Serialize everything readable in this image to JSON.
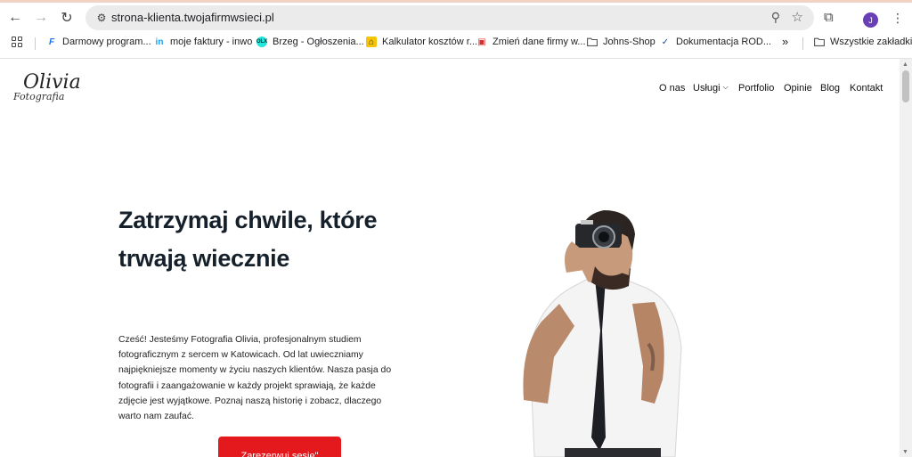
{
  "browser": {
    "url": "strona-klienta.twojafirmwsieci.pl",
    "profile_initial": "J",
    "bookmarks": [
      {
        "label": "Darmowy program...",
        "icon": "F",
        "color": "#1a73e8"
      },
      {
        "label": "moje faktury - inwo",
        "icon": "in",
        "color": "#1da1f2"
      },
      {
        "label": "Brzeg - Ogłoszenia...",
        "icon": "OLX",
        "color": "#23e5db"
      },
      {
        "label": "Kalkulator kosztów r...",
        "icon": "⌂",
        "color": "#f6c400"
      },
      {
        "label": "Zmień dane firmy w...",
        "icon": "▣",
        "color": "#d32f2f"
      },
      {
        "label": "Johns-Shop",
        "icon": "folder",
        "color": "#555"
      },
      {
        "label": "Dokumentacja ROD...",
        "icon": "✓",
        "color": "#1a4b8c"
      }
    ],
    "more_label": "»",
    "all_bookmarks": "Wszystkie zakładki"
  },
  "site": {
    "logo_main": "Olivia",
    "logo_sub": "Fotografia",
    "nav": [
      "O nas",
      "Usługi",
      "Portfolio",
      "Opinie",
      "Blog",
      "Kontakt"
    ],
    "hero_title_line1": "Zatrzymaj chwile, które",
    "hero_title_line2": "trwają wiecznie",
    "hero_text": "Cześć! Jesteśmy Fotografia Olivia, profesjonalnym studiem fotograficznym z sercem w Katowicach. Od lat uwieczniamy najpiękniejsze momenty w życiu naszych klientów. Nasza pasja do fotografii i zaangażowanie w każdy projekt sprawiają, że każde zdjęcie jest wyjątkowe. Poznaj naszą historię i zobacz, dlaczego warto nam zaufać.",
    "cta_label": "Zarezerwuj sesję\""
  }
}
